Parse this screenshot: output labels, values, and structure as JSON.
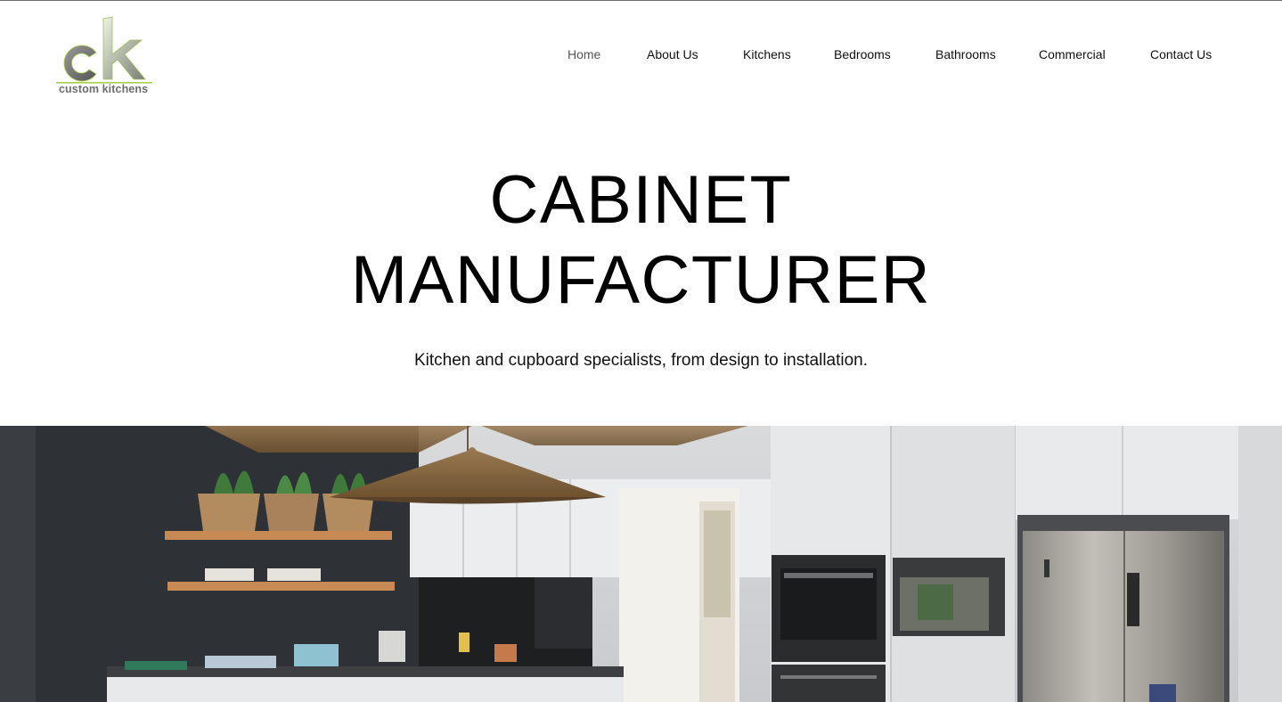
{
  "logo": {
    "letters": "ck",
    "caption": "custom kitchens",
    "accent": "#a6cf4a"
  },
  "nav": {
    "items": [
      {
        "label": "Home",
        "active": true
      },
      {
        "label": "About Us"
      },
      {
        "label": "Kitchens"
      },
      {
        "label": "Bedrooms"
      },
      {
        "label": "Bathrooms"
      },
      {
        "label": "Commercial"
      },
      {
        "label": "Contact Us"
      }
    ]
  },
  "hero": {
    "title_line1": "CABINET",
    "title_line2": "MANUFACTURER",
    "subtitle": "Kitchen and cupboard specialists, from design to installation."
  }
}
